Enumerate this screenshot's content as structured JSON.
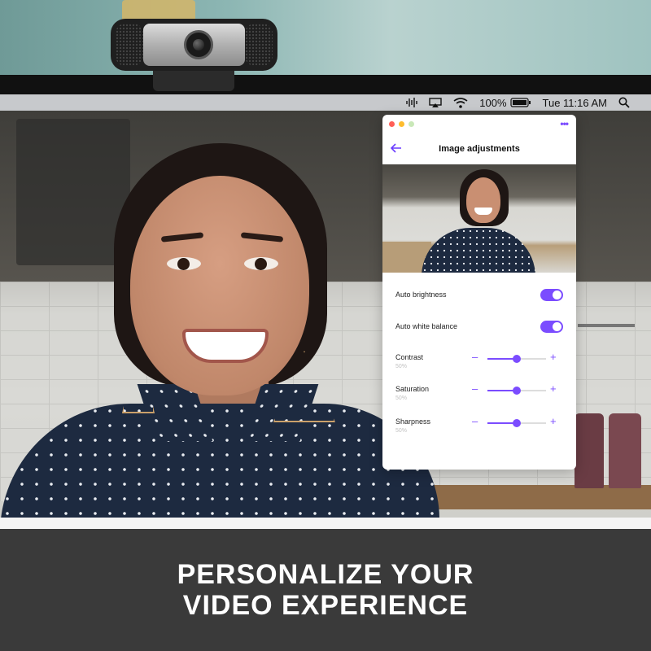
{
  "menubar": {
    "icons": [
      "audio-waveform-icon",
      "airplay-icon",
      "wifi-icon",
      "battery-icon",
      "search-icon"
    ],
    "battery_percent": "100%",
    "clock": "Tue 11:16 AM"
  },
  "app_window": {
    "title": "Image adjustments",
    "back_icon": "back-arrow-icon",
    "more_icon": "more-icon",
    "accent_color": "#7b4cff",
    "toggles": [
      {
        "label": "Auto brightness",
        "on": true
      },
      {
        "label": "Auto white balance",
        "on": true
      }
    ],
    "sliders": [
      {
        "label": "Contrast",
        "value_text": "50%",
        "value": 0.5
      },
      {
        "label": "Saturation",
        "value_text": "50%",
        "value": 0.5
      },
      {
        "label": "Sharpness",
        "value_text": "50%",
        "value": 0.5
      }
    ],
    "minus_glyph": "–",
    "plus_glyph": "+"
  },
  "banner": {
    "line1": "PERSONALIZE YOUR",
    "line2": "VIDEO EXPERIENCE"
  }
}
